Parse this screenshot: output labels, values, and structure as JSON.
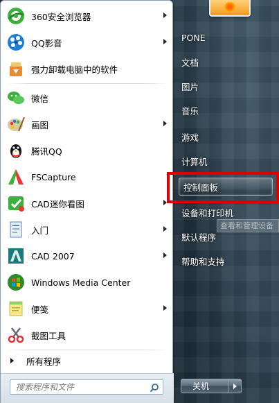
{
  "programs": [
    {
      "label": "360安全浏览器",
      "icon": "360-browser-icon",
      "submenu": true
    },
    {
      "label": "QQ影音",
      "icon": "qq-player-icon",
      "submenu": true
    },
    {
      "label": "强力卸载电脑中的软件",
      "icon": "uninstaller-icon",
      "submenu": false
    },
    {
      "label": "微信",
      "icon": "wechat-icon",
      "submenu": false
    },
    {
      "label": "画图",
      "icon": "paint-icon",
      "submenu": true
    },
    {
      "label": "腾讯QQ",
      "icon": "qq-penguin-icon",
      "submenu": false
    },
    {
      "label": "FSCapture",
      "icon": "fscapture-icon",
      "submenu": false
    },
    {
      "label": "CAD迷你看图",
      "icon": "cad-viewer-icon",
      "submenu": true
    },
    {
      "label": "入门",
      "icon": "getting-started-icon",
      "submenu": true
    },
    {
      "label": "CAD 2007",
      "icon": "autocad-icon",
      "submenu": true
    },
    {
      "label": "Windows Media Center",
      "icon": "media-center-icon",
      "submenu": false
    },
    {
      "label": "便笺",
      "icon": "sticky-notes-icon",
      "submenu": true
    },
    {
      "label": "截图工具",
      "icon": "snipping-tool-icon",
      "submenu": false
    }
  ],
  "all_programs_label": "所有程序",
  "search": {
    "placeholder": "搜索程序和文件"
  },
  "right": {
    "user": "PONE",
    "items": [
      "文档",
      "图片",
      "音乐",
      "游戏",
      "计算机",
      "控制面板",
      "设备和打印机",
      "默认程序",
      "帮助和支持"
    ],
    "highlighted": "控制面板",
    "tooltip": "查看和管理设备"
  },
  "shutdown_label": "关机",
  "colors": {
    "highlight_box": "#e00000",
    "icon_green": "#3cb23c",
    "icon_blue": "#1e7fd8"
  }
}
